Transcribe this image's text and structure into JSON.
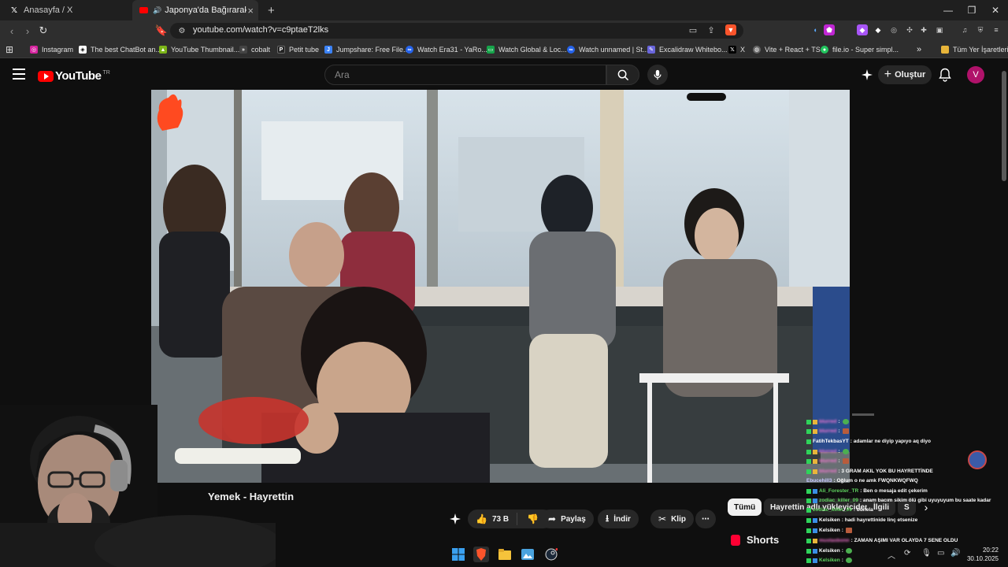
{
  "browser": {
    "tabs": [
      {
        "title": "Anasayfa / X",
        "favicon": "x-icon",
        "active": false
      },
      {
        "title": "Japonya'da Bağırarak Şarkı Sö",
        "favicon": "youtube-icon",
        "active": true
      }
    ],
    "new_tab_label": "+",
    "url": "youtube.com/watch?v=c9ptaeT2lks",
    "bookmarks": [
      {
        "label": "Instagram",
        "color": "#d6249f"
      },
      {
        "label": "The best ChatBot an...",
        "color": "#ffffff"
      },
      {
        "label": "YouTube Thumbnail...",
        "color": "#7cb518"
      },
      {
        "label": "cobalt",
        "color": "#444444"
      },
      {
        "label": "Petit tube",
        "color": "#222222"
      },
      {
        "label": "Jumpshare: Free File...",
        "color": "#3b82f6"
      },
      {
        "label": "Watch Era31 - YaRo...",
        "color": "#2563eb"
      },
      {
        "label": "Watch Global & Loc...",
        "color": "#16a34a"
      },
      {
        "label": "Watch unnamed | St...",
        "color": "#2563eb"
      },
      {
        "label": "Excalidraw Whitebo...",
        "color": "#6965db"
      },
      {
        "label": "X",
        "color": "#000000"
      },
      {
        "label": "Vite + React + TS",
        "color": "#888888"
      },
      {
        "label": "file.io - Super simpl...",
        "color": "#22c55e"
      }
    ],
    "more_bookmarks": "»",
    "all_bookmarks_label": "Tüm Yer İşaretleri"
  },
  "youtube": {
    "logo_text": "YouTube",
    "country_code": "TR",
    "search_placeholder": "Ara",
    "create_label": "Oluştur",
    "avatar_letter": "V"
  },
  "video": {
    "title": "Yemek - Hayrettin"
  },
  "actions": {
    "like_count": "73 B",
    "share_label": "Paylaş",
    "download_label": "İndir",
    "clip_label": "Klip",
    "more_label": "⋯"
  },
  "chips": [
    {
      "label": "Tümü",
      "active": true
    },
    {
      "label": "Hayrettin adlı yükleyiciden",
      "active": false
    },
    {
      "label": "İlgili",
      "active": false
    },
    {
      "label": "S",
      "active": false
    }
  ],
  "shorts_label": "Shorts",
  "chat": {
    "lines": [
      {
        "user": "blurred",
        "text": ":",
        "emote": "#4caf50",
        "user_color": "#ff7ad9"
      },
      {
        "user": "blurred",
        "text": ":",
        "emote": "#b85c3c",
        "user_color": "#ff7ad9"
      },
      {
        "user": "FatihTekbasYT",
        "text": ": adamlar ne diyip yapıyo aq diyo",
        "user_color": "#ffffff"
      },
      {
        "user": "blurred",
        "text": ":",
        "emote": "#4caf50",
        "user_color": "#ff7ad9"
      },
      {
        "user": "blurred",
        "text": ":",
        "emote": "#b85c3c",
        "user_color": "#ff7ad9"
      },
      {
        "user": "blurred",
        "text": ": 3 GRAM AKIL YOK BU HAYRETTİNDE",
        "user_color": "#ff7ad9"
      },
      {
        "user": "Ebucehill3",
        "text": ": Oğlum o ne amk FWQNKWQFWQ",
        "user_color": "#c8c8ff"
      },
      {
        "user": "Ali_Forester_TR",
        "text": ": Ben o mesaja edit çekerim",
        "user_color": "#5fd35f"
      },
      {
        "user": "zodiac_killer_09",
        "text": ": anam bacım sikim ölü gibi uyuyuyum bu saate kadar",
        "user_color": "#5fd35f"
      },
      {
        "user": "zodiac_killer_09",
        "text": ": bunela",
        "user_color": "#5fd35f"
      },
      {
        "user": "Kelsiken",
        "text": ": hadi hayrettinide linç etsenize",
        "user_color": "#ffffff"
      },
      {
        "user": "Kelsiken",
        "text": ":",
        "emote": "#b85c3c",
        "user_color": "#ffffff"
      },
      {
        "user": "mustasbonn",
        "text": ": ZAMAN AŞIMI VAR OLAYDA 7 SENE OLDU",
        "user_color": "#ff7ad9"
      },
      {
        "user": "Kelsiken",
        "text": ":",
        "emote": "#4caf50",
        "user_color": "#ffffff"
      },
      {
        "user": "Kelsiken",
        "text": ":",
        "emote": "#4caf50",
        "user_color": "#5fd35f"
      }
    ]
  },
  "taskbar": {
    "time": "20:22",
    "date": "30.10.2025"
  }
}
